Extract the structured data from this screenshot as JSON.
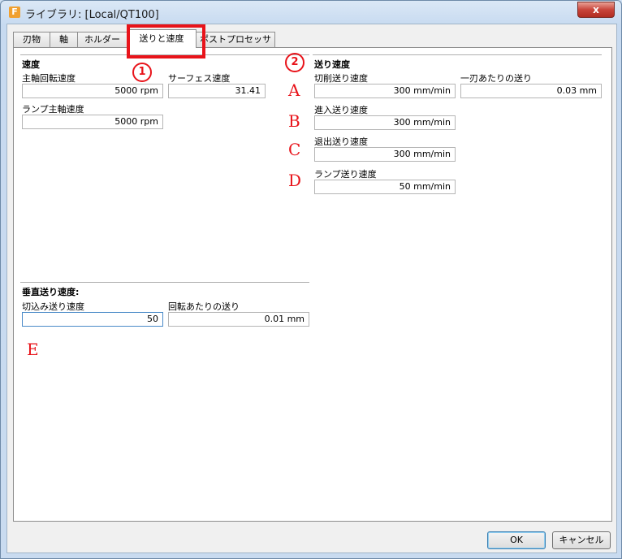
{
  "window": {
    "title": "ライブラリ: [Local/QT100]",
    "app_icon_letter": "F",
    "close_glyph": "x"
  },
  "tabs": [
    {
      "label": "刃物"
    },
    {
      "label": "軸"
    },
    {
      "label": "ホルダー"
    },
    {
      "label": "送りと速度",
      "active": true
    },
    {
      "label": "ポストプロセッサ"
    }
  ],
  "speed": {
    "heading": "速度",
    "spindle": {
      "label": "主軸回転速度",
      "value": "5000 rpm"
    },
    "surface": {
      "label": "サーフェス速度",
      "value": "31.41"
    },
    "ramp_spindle": {
      "label": "ランプ主軸速度",
      "value": "5000 rpm"
    }
  },
  "feed": {
    "heading": "送り速度",
    "cutting": {
      "label": "切削送り速度",
      "value": "300 mm/min"
    },
    "per_tooth": {
      "label": "一刃あたりの送り",
      "value": "0.03 mm"
    },
    "lead_in": {
      "label": "進入送り速度",
      "value": "300 mm/min"
    },
    "lead_out": {
      "label": "退出送り速度",
      "value": "300 mm/min"
    },
    "ramp": {
      "label": "ランプ送り速度",
      "value": "50 mm/min"
    }
  },
  "vertical": {
    "heading": "垂直送り速度:",
    "plunge": {
      "label": "切込み送り速度",
      "value": "50"
    },
    "per_rev": {
      "label": "回転あたりの送り",
      "value": "0.01 mm"
    }
  },
  "annotations": {
    "one": "1",
    "two": "2",
    "A": "A",
    "B": "B",
    "C": "C",
    "D": "D",
    "E": "E",
    "color": "#e8131a"
  },
  "buttons": {
    "ok": "OK",
    "cancel": "キャンセル"
  }
}
